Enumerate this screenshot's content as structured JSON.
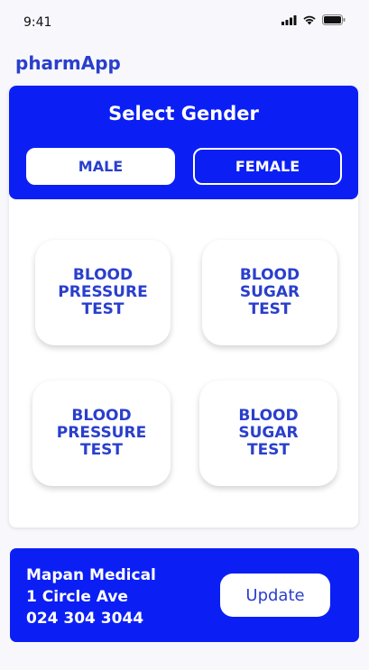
{
  "status_bar": {
    "time": "9:41",
    "icons": [
      "signal-icon",
      "wifi-icon",
      "battery-icon"
    ]
  },
  "app": {
    "title": "pharmApp"
  },
  "gender": {
    "title": "Select Gender",
    "male_label": "MALE",
    "female_label": "FEMALE",
    "selected": "MALE"
  },
  "tests": [
    {
      "line1": "BLOOD",
      "line2": "PRESSURE",
      "line3": "TEST"
    },
    {
      "line1": "BLOOD",
      "line2": "SUGAR",
      "line3": "TEST"
    },
    {
      "line1": "BLOOD",
      "line2": "PRESSURE",
      "line3": "TEST"
    },
    {
      "line1": "BLOOD",
      "line2": "SUGAR",
      "line3": "TEST"
    }
  ],
  "pharmacy": {
    "name": "Mapan Medical",
    "address": "1 Circle Ave",
    "phone": "024 304 3044",
    "update_label": "Update"
  },
  "colors": {
    "primary": "#0b1ff5",
    "text_accent": "#2a3fcc",
    "background": "#f8f8fc",
    "card": "#ffffff"
  }
}
